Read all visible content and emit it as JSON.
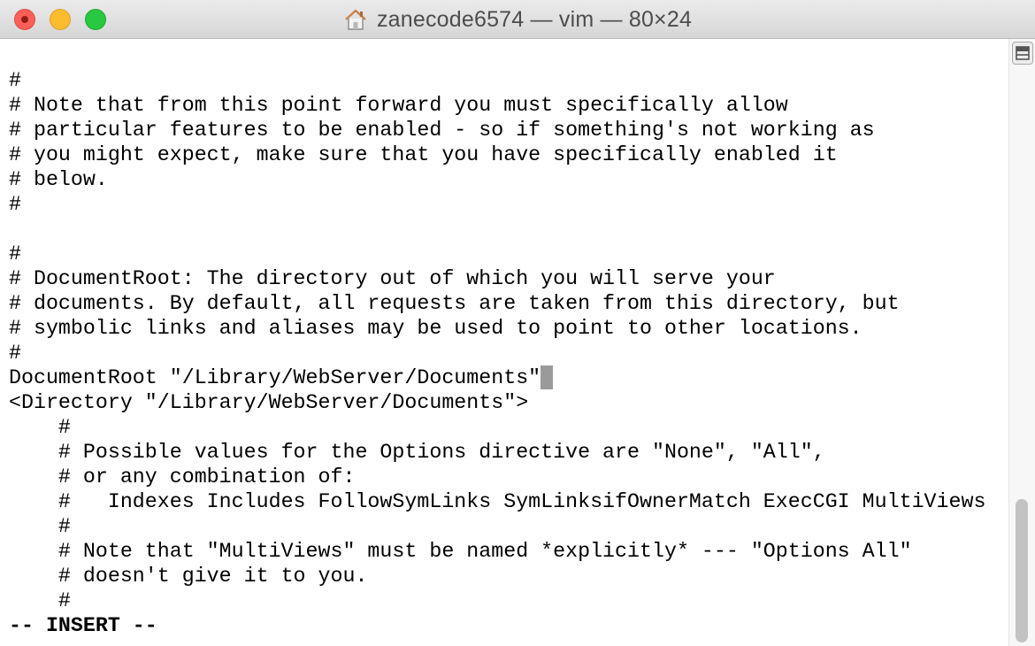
{
  "window": {
    "title": "zanecode6574 — vim — 80×24",
    "title_icon": "home-icon",
    "controls": [
      "close-icon",
      "minimize-icon",
      "zoom-icon"
    ]
  },
  "terminal": {
    "lines": [
      "#",
      "# Note that from this point forward you must specifically allow",
      "# particular features to be enabled - so if something's not working as",
      "# you might expect, make sure that you have specifically enabled it",
      "# below.",
      "#",
      "",
      "#",
      "# DocumentRoot: The directory out of which you will serve your",
      "# documents. By default, all requests are taken from this directory, but",
      "# symbolic links and aliases may be used to point to other locations.",
      "#",
      "DocumentRoot \"/Library/WebServer/Documents\"",
      "<Directory \"/Library/WebServer/Documents\">",
      "    #",
      "    # Possible values for the Options directive are \"None\", \"All\",",
      "    # or any combination of:",
      "    #   Indexes Includes FollowSymLinks SymLinksifOwnerMatch ExecCGI MultiViews",
      "    #",
      "    # Note that \"MultiViews\" must be named *explicitly* --- \"Options All\"",
      "    # doesn't give it to you.",
      "    #"
    ],
    "cursor_line_index": 12,
    "status": "-- INSERT --"
  },
  "colors": {
    "background": "#ffffff",
    "text": "#000000",
    "cursor": "#9a9a9a",
    "close": "#fc5f57",
    "minimize": "#fdbc2e",
    "zoom": "#28c840"
  },
  "scrollbar": {
    "split_icon": "split-pane-icon"
  }
}
